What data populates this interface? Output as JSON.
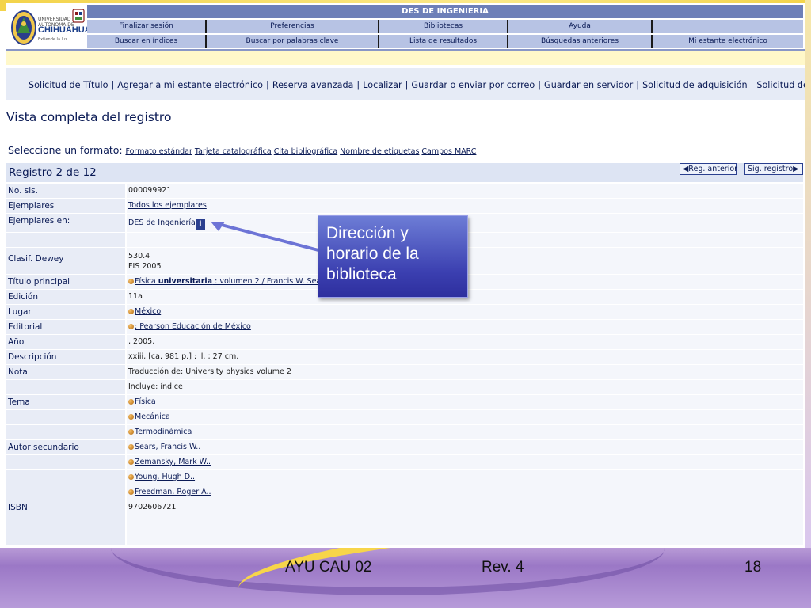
{
  "logo": {
    "university_small": "UNIVERSIDAD AUTONOMA DE",
    "university_name": "CHIHUAHUA",
    "university_sub": "Extiende la luz"
  },
  "header": {
    "top_title": "DES DE INGENIERIA",
    "nav_row1": [
      "Finalizar sesión",
      "Preferencias",
      "Bibliotecas",
      "Ayuda",
      ""
    ],
    "nav_row2": [
      "Buscar en índices",
      "Buscar por palabras clave",
      "Lista de resultados",
      "Búsquedas anteriores",
      "Mi estante electrónico"
    ]
  },
  "actions": [
    "Solicitud de Título",
    "Agregar a mi estante electrónico",
    "Reserva avanzada",
    "Localizar",
    "Guardar o enviar por correo",
    "Guardar en servidor",
    "Solicitud de adquisición",
    "Solicitud de PIB"
  ],
  "view_title": "Vista completa del registro",
  "format": {
    "label": "Seleccione un formato:",
    "options": [
      "Formato estándar",
      "Tarjeta catalográfica",
      "Cita bibliográfica",
      "Nombre de etiquetas",
      "Campos MARC"
    ]
  },
  "record": {
    "count_label": "Registro 2 de 12",
    "prev_label": "◀Reg. anterior",
    "next_label": "Sig. registro▶"
  },
  "fields": {
    "no_sis": {
      "label": "No. sis.",
      "value": "000099921"
    },
    "ejemplares": {
      "label": "Ejemplares",
      "value": "Todos los ejemplares"
    },
    "ejemplares_en": {
      "label": "Ejemplares en:",
      "value": "DES de Ingeniería",
      "icon": "info-icon"
    },
    "clasif": {
      "label": "Clasif. Dewey",
      "value1": "530.4",
      "value2": "FIS 2005"
    },
    "titulo": {
      "label": "Título principal",
      "value_pre": "Física ",
      "value_bold": "universitaria",
      "value_post": " : volumen 2 / Francis W. Sears ... [et al.] ; traducción Física"
    },
    "edicion": {
      "label": "Edición",
      "value": "11a"
    },
    "lugar": {
      "label": "Lugar",
      "value": "México"
    },
    "editorial": {
      "label": "Editorial",
      "value": ": Pearson Educación de México"
    },
    "anio": {
      "label": "Año",
      "value": ", 2005."
    },
    "descripcion": {
      "label": "Descripción",
      "value": "xxiii, [ca. 981 p.] : il. ; 27 cm."
    },
    "nota": {
      "label": "Nota",
      "value1": "Traducción de: University physics volume 2",
      "value2": "Incluye: índice"
    },
    "tema": {
      "label": "Tema",
      "values": [
        "Física",
        "Mecánica",
        "Termodinámica"
      ]
    },
    "autor": {
      "label": "Autor secundario",
      "values": [
        "Sears, Francis W..",
        "Zemansky, Mark W..",
        "Young, Hugh D..",
        "Freedman, Roger A.."
      ]
    },
    "isbn": {
      "label": "ISBN",
      "value": "9702606721"
    }
  },
  "callout": {
    "text": "Dirección y horario de la biblioteca"
  },
  "footer": {
    "code": "AYU CAU 02",
    "rev": "Rev. 4",
    "page": "18"
  },
  "colors": {
    "nav_bar": "#6d7fb8",
    "nav_row": "#b7c3e4",
    "callout": "#3b3fb0",
    "footer": "#9b78c6",
    "accent_yellow": "#f7d54a"
  }
}
